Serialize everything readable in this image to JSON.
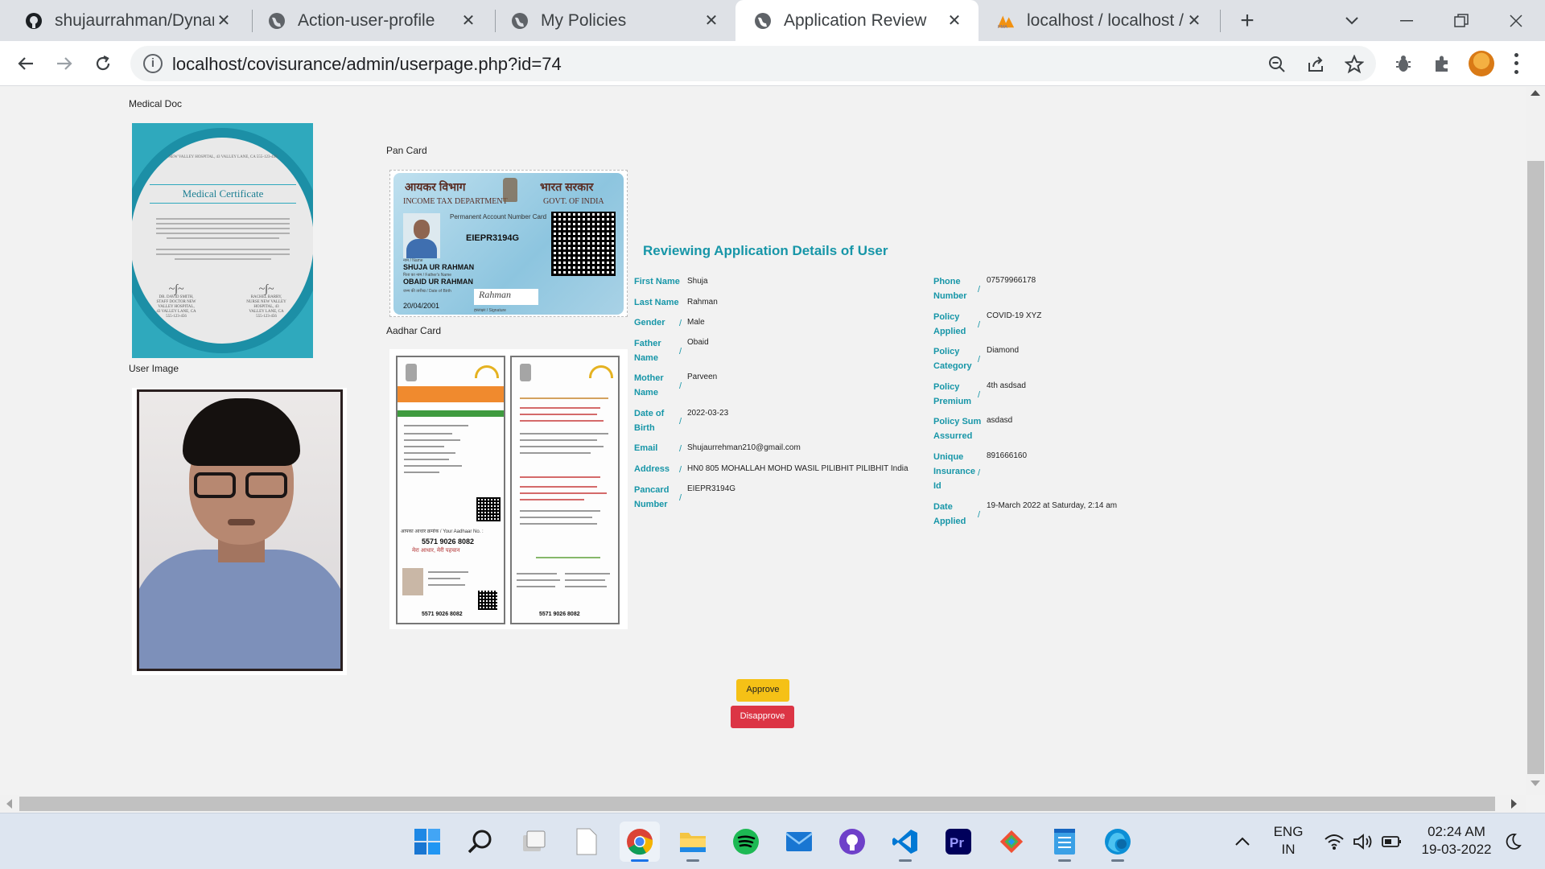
{
  "browser": {
    "tabs": [
      {
        "title": "shujaurrahman/Dynamic-",
        "icon": "github-icon",
        "active": false
      },
      {
        "title": "Action-user-profile",
        "icon": "globe-icon",
        "active": false
      },
      {
        "title": "My Policies",
        "icon": "globe-icon",
        "active": false
      },
      {
        "title": "Application Review",
        "icon": "globe-icon",
        "active": true
      },
      {
        "title": "localhost / localhost / cov",
        "icon": "phpmyadmin-icon",
        "active": false
      }
    ],
    "url": "localhost/covisurance/admin/userpage.php?id=74"
  },
  "documents": {
    "medical_doc_label": "Medical Doc",
    "user_image_label": "User Image",
    "pan_card_label": "Pan Card",
    "aadhar_card_label": "Aadhar Card",
    "medical_certificate": {
      "header": "NEW VALLEY HOSPITAL, 43 VALLEY LANE, CA 555-123-456",
      "title": "Medical Certificate",
      "signer_left": "DR. DAVID SMITH, STAFF DOCTOR NEW VALLEY HOSPITAL, 43 VALLEY LANE, CA 555-123-456",
      "signer_right": "RACHEL BARRY, NURSE NEW VALLEY HOSPITAL, 43 VALLEY LANE, CA 555-123-456"
    },
    "pan": {
      "dept_hindi": "आयकर विभाग",
      "govt_hindi": "भारत सरकार",
      "dept_english": "INCOME TAX DEPARTMENT",
      "govt_english": "GOVT. OF INDIA",
      "card_title": "Permanent Account Number Card",
      "number": "EIEPR3194G",
      "name_label": "नाम / Name",
      "name": "SHUJA UR RAHMAN",
      "father_label": "पिता का नाम / Father's Name",
      "father": "OBAID UR RAHMAN",
      "dob_label": "जन्म की तारीख / Date of Birth",
      "dob": "20/04/2001",
      "signature_label": "हस्ताक्षर / Signature",
      "signature": "Rahman"
    },
    "aadhar": {
      "number": "5571 9026 8082",
      "number_back": "5571 9026 8082",
      "tagline": "मेरा आधार, मेरी पहचान",
      "your_aadhaar_no": "आपका आधार क्रमांक / Your Aadhaar No. :"
    }
  },
  "details": {
    "title": "Reviewing Application Details of User",
    "left": [
      {
        "label": "First Name",
        "value": "Shuja"
      },
      {
        "label": "Last Name",
        "value": "Rahman"
      },
      {
        "label": "Gender",
        "value": "Male"
      },
      {
        "label": "Father Name",
        "value": "Obaid"
      },
      {
        "label": "Mother Name",
        "value": "Parveen"
      },
      {
        "label": "Date of Birth",
        "value": "2022-03-23"
      },
      {
        "label": "Email",
        "value": "Shujaurrehman210@gmail.com"
      },
      {
        "label": "Address",
        "value": "HN0 805 MOHALLAH MOHD WASIL PILIBHIT PILIBHIT India"
      },
      {
        "label": "Pancard Number",
        "value": "EIEPR3194G"
      }
    ],
    "right": [
      {
        "label": "Phone Number",
        "value": "07579966178"
      },
      {
        "label": "Policy Applied",
        "value": "COVID-19 XYZ"
      },
      {
        "label": "Policy Category",
        "value": "Diamond"
      },
      {
        "label": "Policy Premium",
        "value": "4th asdsad"
      },
      {
        "label": "Policy Sum Assurred",
        "value": "asdasd"
      },
      {
        "label": "Unique Insurance Id",
        "value": "891666160"
      },
      {
        "label": "Date Applied",
        "value": "19-March 2022 at Saturday, 2:14 am"
      }
    ],
    "separator": "/"
  },
  "actions": {
    "approve": "Approve",
    "disapprove": "Disapprove"
  },
  "taskbar": {
    "apps": [
      "windows-start-icon",
      "search-icon",
      "task-view-icon",
      "notepad-file-icon",
      "chrome-icon",
      "file-explorer-icon",
      "spotify-icon",
      "mail-icon",
      "github-desktop-icon",
      "vscode-icon",
      "premiere-pro-icon",
      "git-icon",
      "notepad-icon",
      "edge-icon"
    ],
    "language": "ENG",
    "region": "IN",
    "time": "02:24 AM",
    "date": "19-03-2022"
  },
  "colors": {
    "accent_teal": "#1796a8",
    "approve_yellow": "#f5c116",
    "disapprove_red": "#dc3545"
  }
}
